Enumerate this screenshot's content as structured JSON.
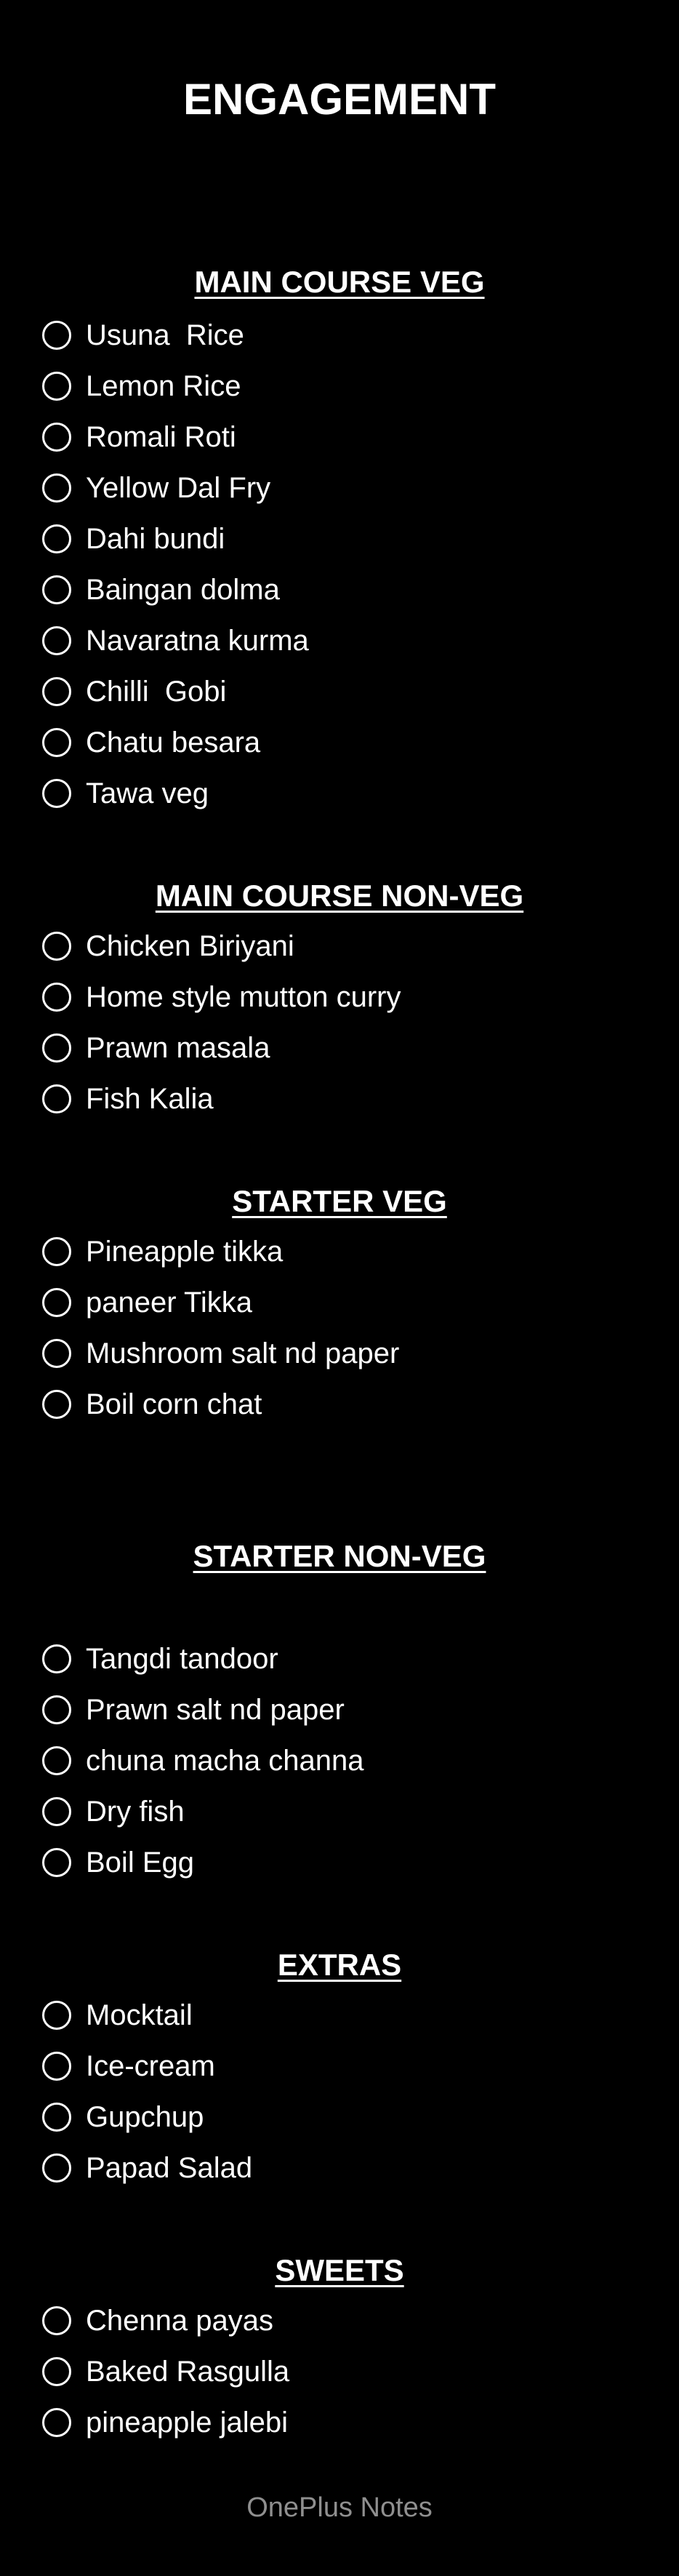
{
  "note": {
    "title": "ENGAGEMENT",
    "footer": "OnePlus Notes",
    "sections": [
      {
        "heading": "MAIN COURSE VEG",
        "items": [
          "Usuna  Rice",
          "Lemon Rice",
          "Romali Roti",
          "Yellow Dal Fry",
          "Dahi bundi",
          "Baingan dolma",
          "Navaratna kurma",
          "Chilli  Gobi",
          "Chatu besara",
          "Tawa veg"
        ]
      },
      {
        "heading": "MAIN COURSE NON-VEG",
        "items": [
          "Chicken Biriyani",
          "Home style mutton curry",
          "Prawn masala",
          "Fish Kalia"
        ]
      },
      {
        "heading": "STARTER VEG",
        "items": [
          "Pineapple tikka",
          "paneer Tikka",
          "Mushroom salt nd paper",
          "Boil corn chat"
        ]
      },
      {
        "heading": "STARTER NON-VEG",
        "items": [
          "Tangdi tandoor",
          "Prawn salt nd paper",
          "chuna macha channa",
          "Dry fish",
          "Boil Egg"
        ]
      },
      {
        "heading": "EXTRAS",
        "items": [
          "Mocktail",
          "Ice-cream",
          "Gupchup",
          "Papad Salad"
        ]
      },
      {
        "heading": "SWEETS",
        "items": [
          "Chenna payas",
          "Baked Rasgulla",
          "pineapple jalebi"
        ]
      }
    ]
  },
  "colors": {
    "background": "#000000",
    "text": "#ffffff",
    "footer_text": "#8f8f8f"
  },
  "icons": {
    "checkbox": "empty-circle-checkbox-icon"
  }
}
